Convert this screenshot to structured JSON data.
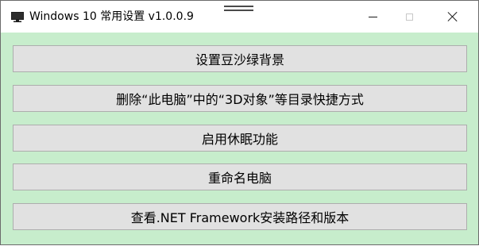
{
  "window": {
    "title": "Windows 10 常用设置 v1.0.0.9",
    "icon": "monitor-icon",
    "controls": {
      "minimize_icon": "minimize-icon",
      "maximize_icon": "maximize-icon",
      "close_icon": "close-icon"
    }
  },
  "buttons": [
    {
      "label": "设置豆沙绿背景"
    },
    {
      "label": "删除“此电脑”中的“3D对象”等目录快捷方式"
    },
    {
      "label": "启用休眠功能"
    },
    {
      "label": "重命名电脑"
    },
    {
      "label": "查看.NET Framework安装路径和版本"
    }
  ],
  "colors": {
    "client_background": "#c7edcc",
    "button_face": "#e1e1e1",
    "button_border": "#adadad"
  }
}
